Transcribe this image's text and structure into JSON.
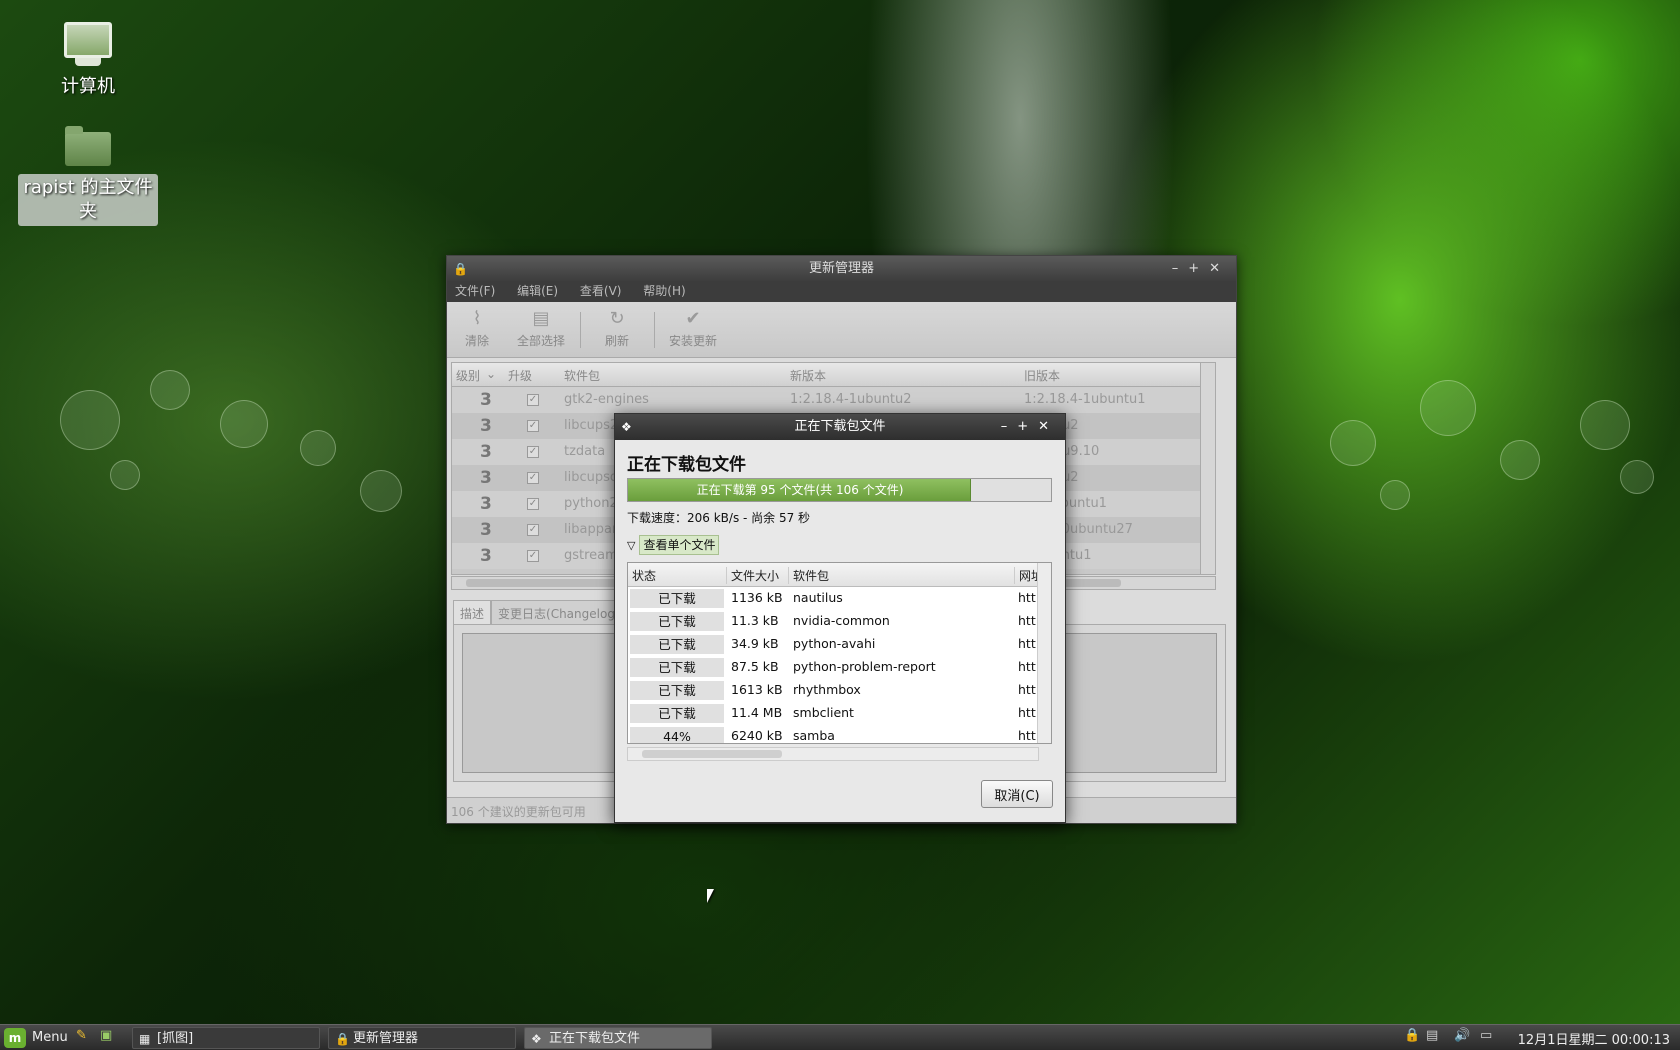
{
  "desktop": {
    "icons": [
      {
        "label": "计算机"
      },
      {
        "label": "rapist 的主文件夹"
      }
    ]
  },
  "update_manager": {
    "title": "更新管理器",
    "menu": [
      "文件(F)",
      "编辑(E)",
      "查看(V)",
      "帮助(H)"
    ],
    "toolbar": {
      "clear": "清除",
      "select_all": "全部选择",
      "refresh": "刷新",
      "install": "安装更新"
    },
    "columns": {
      "level": "级别",
      "upgrade": "升级",
      "package": "软件包",
      "new_version": "新版本",
      "old_version": "旧版本"
    },
    "rows": [
      {
        "level": "3",
        "name": "gtk2-engines",
        "new": "1:2.18.4-1ubuntu2",
        "old": "1:2.18.4-1ubuntu1"
      },
      {
        "level": "3",
        "name": "libcups2",
        "new": "",
        "old": "ubuntu2"
      },
      {
        "level": "3",
        "name": "tzdata",
        "new": "",
        "old": "ubuntu9.10"
      },
      {
        "level": "3",
        "name": "libcupsdi",
        "new": "",
        "old": "ubuntu2"
      },
      {
        "level": "3",
        "name": "python2",
        "new": "",
        "old": "c2-0ubuntu1"
      },
      {
        "level": "3",
        "name": "libappar",
        "new": "",
        "old": "1403-0ubuntu27"
      },
      {
        "level": "3",
        "name": "gstream",
        "new": "",
        "old": "-2ubuntu1"
      }
    ],
    "tabs": [
      "描述",
      "变更日志(Changelog)"
    ],
    "status": "106 个建议的更新包可用"
  },
  "download_dialog": {
    "title": "正在下载包文件",
    "heading": "正在下载包文件",
    "progress_text": "正在下载第 95 个文件(共 106 个文件)",
    "progress_fraction": 0.81,
    "speed": "下载速度：206 kB/s - 尚余 57 秒",
    "expander_label": "查看单个文件",
    "columns": {
      "status": "状态",
      "size": "文件大小",
      "package": "软件包",
      "url": "网址"
    },
    "files": [
      {
        "status": "已下载",
        "size": "1136 kB",
        "package": "nautilus",
        "url": "htt"
      },
      {
        "status": "已下载",
        "size": "11.3 kB",
        "package": "nvidia-common",
        "url": "htt"
      },
      {
        "status": "已下载",
        "size": "34.9 kB",
        "package": "python-avahi",
        "url": "htt"
      },
      {
        "status": "已下载",
        "size": "87.5 kB",
        "package": "python-problem-report",
        "url": "htt"
      },
      {
        "status": "已下载",
        "size": "1613 kB",
        "package": "rhythmbox",
        "url": "htt"
      },
      {
        "status": "已下载",
        "size": "11.4 MB",
        "package": "smbclient",
        "url": "htt"
      },
      {
        "status": "44%",
        "size": "6240 kB",
        "package": "samba",
        "url": "htt"
      }
    ],
    "cancel_label": "取消(C)"
  },
  "taskbar": {
    "menu_label": "Menu",
    "tasks": [
      {
        "label": "[抓图]"
      },
      {
        "label": "更新管理器"
      },
      {
        "label": "正在下载包文件"
      }
    ],
    "clock": "12月1日星期二 00:00:13"
  },
  "colors": {
    "progress_fill": "#7ab04a",
    "desktop_accent": "#4caf20"
  }
}
